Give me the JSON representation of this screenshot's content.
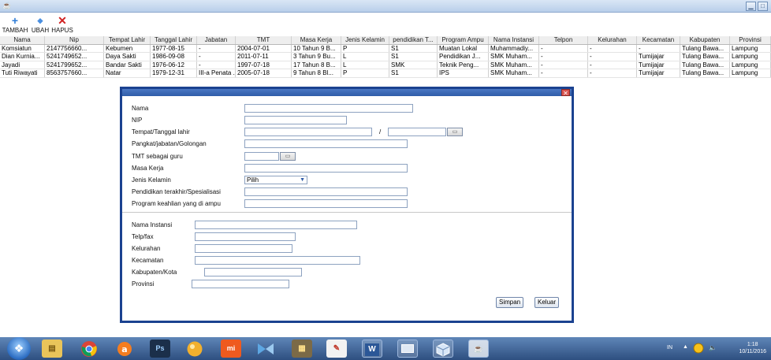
{
  "window": {
    "icon": "app-icon",
    "controls": [
      "minimize-icon",
      "maximize-icon"
    ]
  },
  "toolbar": {
    "tambah_label": "TAMBAH",
    "ubah_label": "UBAH",
    "hapus_label": "HAPUS"
  },
  "table": {
    "columns": [
      "Nama",
      "Nip",
      "Tempat Lahir",
      "Tanggal Lahir",
      "Jabatan",
      "TMT",
      "Masa Kerja",
      "Jenis Kelamin",
      "pendidikan T...",
      "Program Ampu",
      "Nama Instansi",
      "Telpon",
      "Kelurahan",
      "Kecamatan",
      "Kabupaten",
      "Provinsi"
    ],
    "rows": [
      [
        "Komsiatun",
        "2147756660...",
        "Kebumen",
        "1977-08-15",
        "-",
        "2004-07-01",
        "10 Tahun 9 B...",
        "P",
        "S1",
        "Muatan Lokal",
        "Muhammadiy...",
        "-",
        "-",
        "-",
        "Tulang Bawa...",
        "Lampung"
      ],
      [
        "Dian Kurnia...",
        "5241749652...",
        "Daya Sakti",
        "1986-09-08",
        "-",
        "2011-07-11",
        "3 Tahun 9 Bu...",
        "L",
        "S1",
        "Pendidikan J...",
        "SMK Muham...",
        "-",
        "-",
        "Tumijajar",
        "Tulang Bawa...",
        "Lampung"
      ],
      [
        "Jayadi",
        "5241799652...",
        "Bandar Sakti",
        "1976-06-12",
        "-",
        "1997-07-18",
        "17 Tahun 8 B...",
        "L",
        "SMK",
        "Teknik Peng...",
        "SMK Muham...",
        "-",
        "-",
        "Tumijajar",
        "Tulang Bawa...",
        "Lampung"
      ],
      [
        "Tuti Riwayati",
        "8563757660...",
        "Natar",
        "1979-12-31",
        "III-a Penata ...",
        "2005-07-18",
        "9 Tahun 8 Bl...",
        "P",
        "S1",
        "IPS",
        "SMK Muham...",
        "-",
        "-",
        "Tumijajar",
        "Tulang Bawa...",
        "Lampung"
      ]
    ]
  },
  "dialog": {
    "labels": {
      "nama": "Nama",
      "nip": "NIP",
      "ttl": "Tempat/Tanggal lahir",
      "pangkat": "Pangkat/jabatan/Golongan",
      "tmt": "TMT sebagai guru",
      "masa_kerja": "Masa Kerja",
      "jenis_kelamin": "Jenis Kelamin",
      "pendidikan": "Pendidikan terakhir/Spesialisasi",
      "program": "Program keahlian yang di ampu",
      "nama_instansi": "Nama Instansi",
      "telp": "Telp/fax",
      "kelurahan": "Kelurahan",
      "kecamatan": "Kecamatan",
      "kabupaten": "Kabupaten/Kota",
      "provinsi": "Provinsi"
    },
    "date_separator": "/",
    "jenis_kelamin_selected": "Pilih",
    "simpan_label": "Simpan",
    "keluar_label": "Keluar"
  },
  "taskbar": {
    "apps": [
      "file-explorer-icon",
      "chrome-icon",
      "avast-icon",
      "photoshop-icon",
      "corel-icon",
      "mi-icon",
      "netbeans-icon",
      "winrar-icon",
      "paint-icon",
      "word-icon",
      "display-icon",
      "virtualbox-icon",
      "java-icon"
    ],
    "ps_text": "Ps",
    "mi_text": "mi",
    "word_text": "W",
    "language": "IN",
    "time": "1:18",
    "date": "10/11/2016"
  },
  "colors": {
    "dialog_border": "#1b4290",
    "taskbar": "#3a5f92",
    "close_red": "#d9534f"
  }
}
